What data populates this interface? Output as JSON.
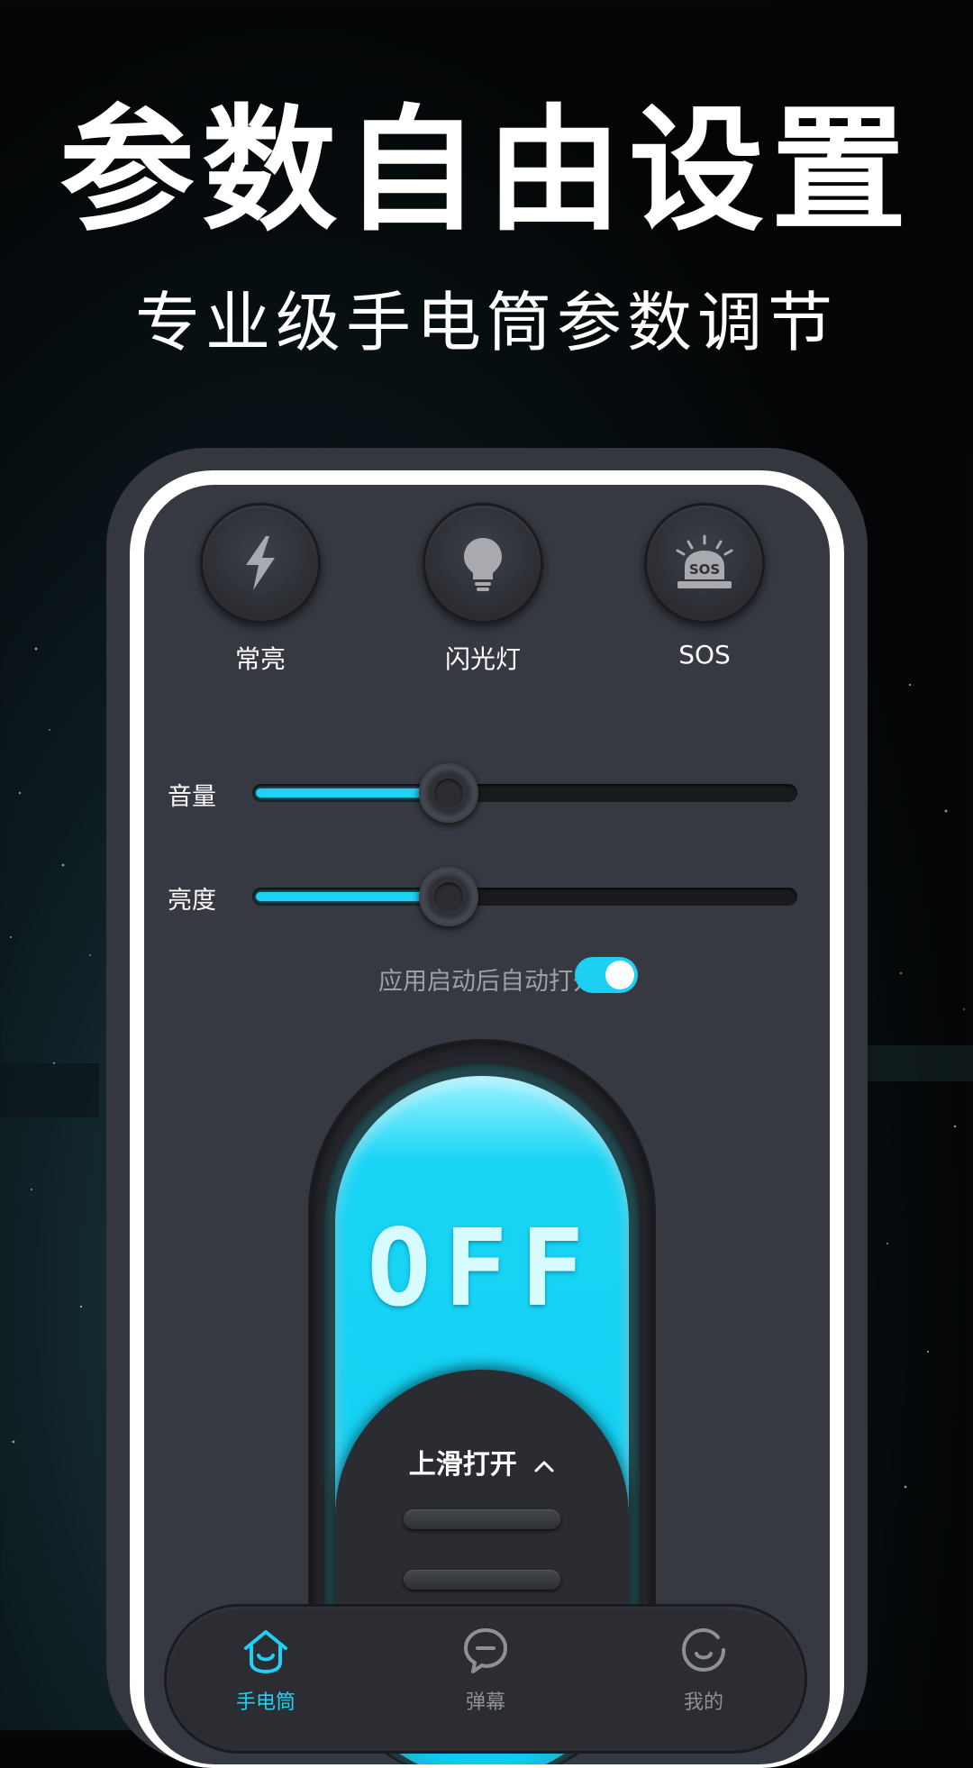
{
  "headline": "参数自由设置",
  "subheadline": "专业级手电筒参数调节",
  "modes": [
    {
      "label": "常亮",
      "icon": "lightning-icon"
    },
    {
      "label": "闪光灯",
      "icon": "bulb-icon"
    },
    {
      "label": "SOS",
      "icon": "sos-siren-icon"
    }
  ],
  "sliders": [
    {
      "label": "音量",
      "value": 0.36
    },
    {
      "label": "亮度",
      "value": 0.36
    }
  ],
  "auto_open": {
    "label": "应用启动后自动打开",
    "enabled": true
  },
  "power_switch": {
    "state_label": "OFF",
    "slide_hint": "上滑打开"
  },
  "tabs": [
    {
      "label": "手电筒",
      "icon": "flashlight-home-icon",
      "active": true
    },
    {
      "label": "弹幕",
      "icon": "chat-bubble-icon",
      "active": false
    },
    {
      "label": "我的",
      "icon": "profile-face-icon",
      "active": false
    }
  ],
  "colors": {
    "accent": "#1fd1f5",
    "panel": "#363941",
    "inactive_tab": "#8d9096"
  }
}
